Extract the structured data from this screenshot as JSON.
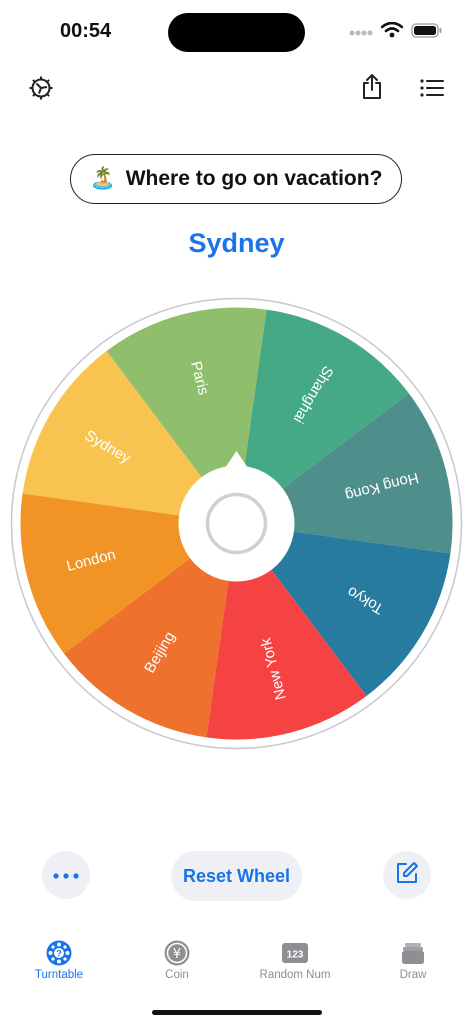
{
  "status": {
    "time": "00:54"
  },
  "header": {
    "settings_icon": "gear-icon",
    "share_icon": "share-icon",
    "list_icon": "list-icon"
  },
  "question": {
    "emoji": "🏝️",
    "text": "Where to go on vacation?"
  },
  "result": "Sydney",
  "wheel": {
    "rotation_deg": -82,
    "segments": [
      {
        "label": "Sydney",
        "color": "#F8C44F"
      },
      {
        "label": "Paris",
        "color": "#8FBF6C"
      },
      {
        "label": "Shanghai",
        "color": "#45A985"
      },
      {
        "label": "Hong Kong",
        "color": "#4E8F8C"
      },
      {
        "label": "Tokyo",
        "color": "#277B9E"
      },
      {
        "label": "New York",
        "color": "#F54242"
      },
      {
        "label": "Beijing",
        "color": "#EE712E"
      },
      {
        "label": "London",
        "color": "#F29325"
      }
    ]
  },
  "actions": {
    "more_icon": "more-icon",
    "reset_label": "Reset Wheel",
    "edit_icon": "edit-icon"
  },
  "tabs": [
    {
      "label": "Turntable",
      "icon": "turntable-icon",
      "active": true
    },
    {
      "label": "Coin",
      "icon": "coin-icon",
      "active": false
    },
    {
      "label": "Random Num",
      "icon": "random-number-icon",
      "active": false,
      "icon_text": "123"
    },
    {
      "label": "Draw",
      "icon": "draw-icon",
      "active": false
    }
  ],
  "colors": {
    "accent": "#1a73e8"
  }
}
